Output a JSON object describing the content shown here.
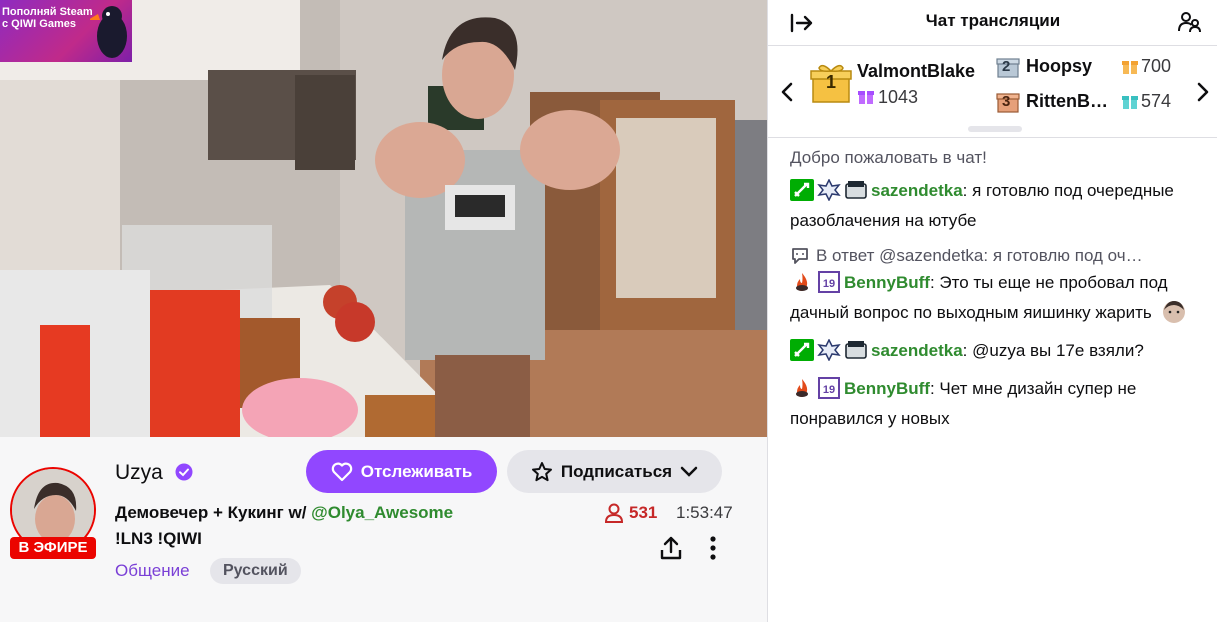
{
  "promo": {
    "line1": "Пополняй Steam",
    "line2": "с QIWI Games"
  },
  "channel": {
    "streamer": "Uzya",
    "live_label": "В ЭФИРЕ",
    "follow_label": "Отслеживать",
    "subscribe_label": "Подписаться",
    "title_prefix": "Демовечер + Кукинг w/ ",
    "title_mention": "@Olya_Awesome",
    "title_line2": "!LN3 !QIWI",
    "viewers": "531",
    "uptime": "1:53:47",
    "category": "Общение",
    "tag": "Русский"
  },
  "colors": {
    "accent": "#9147ff",
    "live": "#eb0400",
    "username_green": "#2f8b2f"
  },
  "chat": {
    "title": "Чат трансляции",
    "leaderboard": {
      "first": {
        "rank": "1",
        "name": "ValmontBlake",
        "value": "1043"
      },
      "second": {
        "rank": "2",
        "name": "Hoopsy",
        "value": "700"
      },
      "third": {
        "rank": "3",
        "name": "RittenB…",
        "value": "574"
      }
    },
    "welcome": "Добро пожаловать в чат!",
    "messages": [
      {
        "user": "sazendetka",
        "text": ": я готовлю под очередные разоблачения на ютубе"
      },
      {
        "reply_to": "В ответ @sazendetka: я готовлю под оч…"
      },
      {
        "user": "BennyBuff",
        "text": ": Это ты еще не пробовал под дачный вопрос по выходным яишинку жарить"
      },
      {
        "user": "sazendetka",
        "text": ": @uzya вы 17е взяли?"
      },
      {
        "user": "BennyBuff",
        "text": ": Чет мне дизайн супер не понравился у новых"
      }
    ]
  }
}
